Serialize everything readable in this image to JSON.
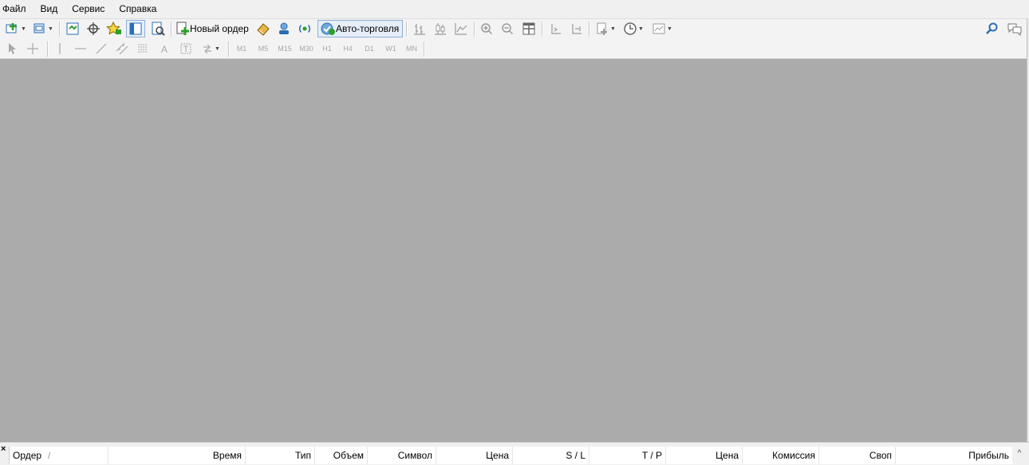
{
  "menu": {
    "items": [
      "Файл",
      "Вид",
      "Сервис",
      "Справка"
    ]
  },
  "toolbar": {
    "new_order_label": "Новый ордер",
    "autotrading_label": "Авто-торговля"
  },
  "timeframes": [
    "M1",
    "M5",
    "M15",
    "M30",
    "H1",
    "H4",
    "D1",
    "W1",
    "MN"
  ],
  "terminal": {
    "columns": [
      "Ордер",
      "Время",
      "Тип",
      "Объем",
      "Символ",
      "Цена",
      "S / L",
      "T / P",
      "Цена",
      "Комиссия",
      "Своп",
      "Прибыль"
    ],
    "sort_indicator": "/",
    "close_glyph": "×",
    "scroll_glyph": "^"
  },
  "colors": {
    "chart_background": "#ababab",
    "toolbar_background": "#f3f3f3",
    "pressed_border": "#8eb1d9",
    "icon_green": "#2e9e2e",
    "icon_blue": "#2a6db5"
  }
}
